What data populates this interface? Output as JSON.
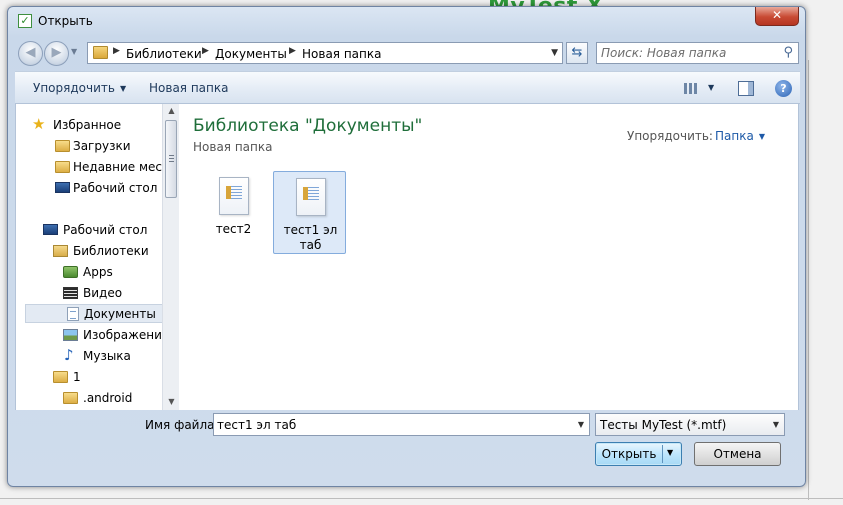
{
  "window": {
    "title": "Открыть",
    "close_label": "✕",
    "background_app_title": "MyTest X"
  },
  "address_bar": {
    "breadcrumbs": [
      "Библиотеки",
      "Документы",
      "Новая папка"
    ]
  },
  "search": {
    "placeholder": "Поиск: Новая папка"
  },
  "toolbar": {
    "organize_label": "Упорядочить",
    "new_folder_label": "Новая папка"
  },
  "navigation": {
    "items": [
      {
        "label": "Избранное",
        "icon": "star-icon"
      },
      {
        "label": "Загрузки",
        "icon": "downloads-folder-icon"
      },
      {
        "label": "Недавние места",
        "icon": "recent-places-icon"
      },
      {
        "label": "Рабочий стол",
        "icon": "desktop-icon"
      },
      {
        "label": "Рабочий стол",
        "icon": "desktop-icon"
      },
      {
        "label": "Библиотеки",
        "icon": "libraries-icon"
      },
      {
        "label": "Apps",
        "icon": "apps-icon"
      },
      {
        "label": "Видео",
        "icon": "video-icon"
      },
      {
        "label": "Документы",
        "icon": "documents-icon",
        "selected": true
      },
      {
        "label": "Изображения",
        "icon": "pictures-icon"
      },
      {
        "label": "Музыка",
        "icon": "music-icon"
      },
      {
        "label": "1",
        "icon": "folder-icon"
      },
      {
        "label": ".android",
        "icon": "folder-icon"
      }
    ]
  },
  "library": {
    "title": "Библиотека \"Документы\"",
    "subtitle": "Новая папка",
    "arrange_label": "Упорядочить:",
    "arrange_value": "Папка"
  },
  "files": [
    {
      "name": "тест2",
      "selected": false
    },
    {
      "name": "тест1 эл таб",
      "selected": true
    }
  ],
  "bottom": {
    "filename_label": "Имя файла:",
    "filename_value": "тест1 эл таб",
    "filter_value": "Тесты MyTest (*.mtf)",
    "open_label": "Открыть",
    "cancel_label": "Отмена"
  }
}
